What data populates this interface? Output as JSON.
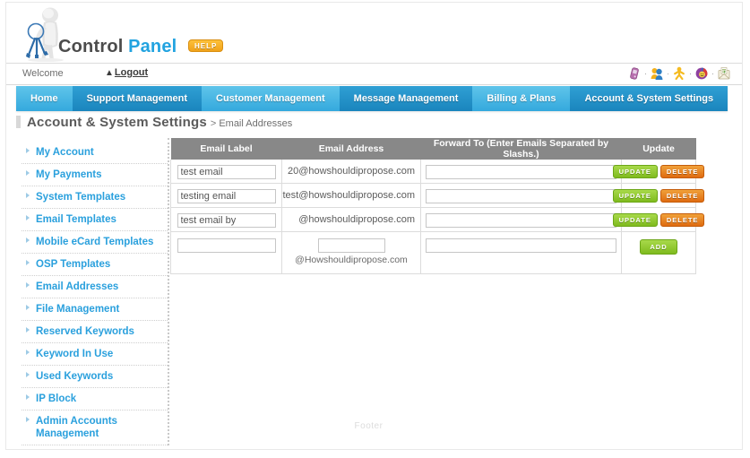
{
  "brand": {
    "word1": "Control",
    "word2": "Panel",
    "help_label": "HELP",
    "logo_icon": "mascot-with-keys-icon"
  },
  "welcome_bar": {
    "welcome_text": "Welcome",
    "logout_label": "Logout",
    "logout_arrow_icon": "up-arrow-icon",
    "icons": [
      {
        "name": "mobile-phone-icon",
        "color": "#c87ab5"
      },
      {
        "name": "user-group-icon",
        "color": "#2f7fc4"
      },
      {
        "name": "person-yellow-icon",
        "color": "#f0b51a"
      },
      {
        "name": "smiley-badge-icon",
        "color": "#8e3fa0"
      },
      {
        "name": "mail-envelope-icon",
        "color": "#6aa84f"
      }
    ],
    "icon_separator": "·"
  },
  "mainnav": {
    "tabs": [
      {
        "label": "Home",
        "style": "light"
      },
      {
        "label": "Support Management",
        "style": "dark"
      },
      {
        "label": "Customer Management",
        "style": "light"
      },
      {
        "label": "Message Management",
        "style": "dark"
      },
      {
        "label": "Billing & Plans",
        "style": "light"
      },
      {
        "label": "Account & System Settings",
        "style": "dark"
      }
    ]
  },
  "page_title": {
    "title": "Account & System Settings",
    "separator": ">",
    "current": "Email Addresses"
  },
  "sidebar": {
    "items": [
      {
        "label": "My Account"
      },
      {
        "label": "My Payments"
      },
      {
        "label": "System Templates"
      },
      {
        "label": "Email Templates"
      },
      {
        "label": "Mobile eCard Templates"
      },
      {
        "label": "OSP Templates"
      },
      {
        "label": "Email Addresses"
      },
      {
        "label": "File Management"
      },
      {
        "label": "Reserved Keywords"
      },
      {
        "label": "Keyword In Use"
      },
      {
        "label": "Used Keywords"
      },
      {
        "label": "IP Block"
      },
      {
        "label": "Admin Accounts Management"
      }
    ]
  },
  "table": {
    "headers": [
      "Email Label",
      "Email Address",
      "Forward To (Enter Emails Separated by Slashs.)",
      "Update"
    ],
    "rows": [
      {
        "label_value": "test email",
        "label_placeholder": "",
        "address": "20@howshouldipropose.com",
        "forward_value": "",
        "forward_placeholder": "",
        "update_label": "UPDATE",
        "delete_label": "DELETE"
      },
      {
        "label_value": "testing email",
        "label_placeholder": "",
        "address": "test@howshouldipropose.com",
        "forward_value": "",
        "forward_placeholder": "",
        "update_label": "UPDATE",
        "delete_label": "DELETE"
      },
      {
        "label_value": "test email by",
        "label_placeholder": "",
        "address": "@howshouldipropose.com",
        "forward_value": "",
        "forward_placeholder": "",
        "update_label": "UPDATE",
        "delete_label": "DELETE"
      }
    ],
    "new_row": {
      "label_value": "",
      "label_placeholder": "",
      "address_value": "",
      "address_placeholder": "",
      "address_suffix": "@Howshouldipropose.com",
      "forward_value": "",
      "forward_placeholder": "",
      "add_label": "ADD"
    }
  },
  "footer": {
    "text": "Footer"
  },
  "colors": {
    "brand_blue": "#22a3e0",
    "nav_light": "#5fc4ea",
    "nav_dark": "#2f9fd4",
    "header_gray": "#888888",
    "update_green": "#7fbb1e",
    "delete_orange": "#df6b10",
    "link_blue": "#2aa0dd"
  }
}
